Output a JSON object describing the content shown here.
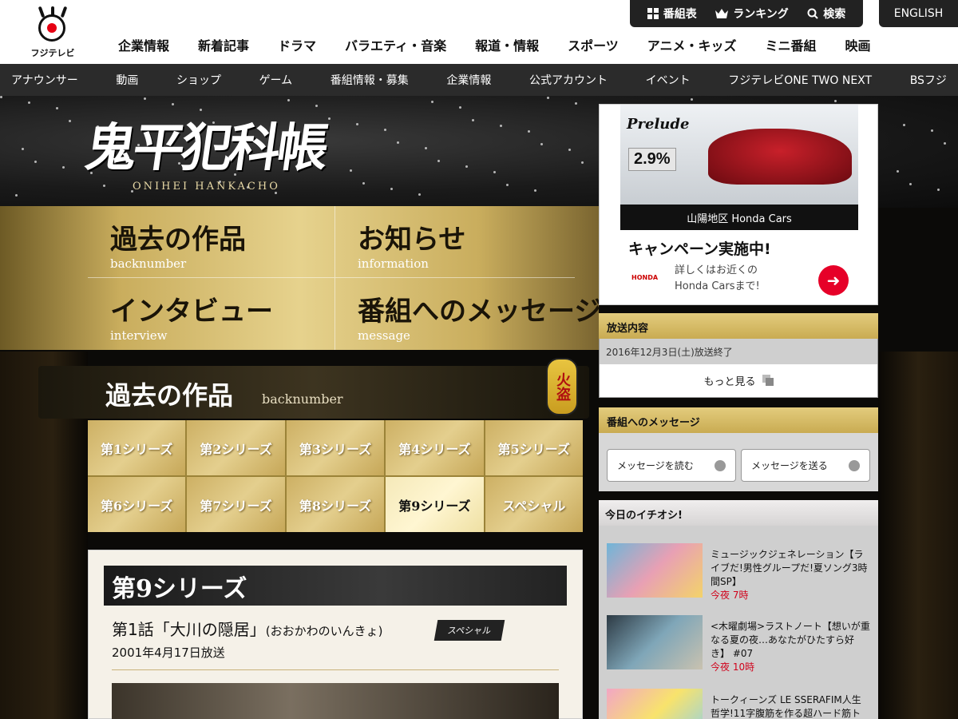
{
  "header": {
    "logo_text": "フジテレビ",
    "util": [
      {
        "icon": "grid-icon",
        "label": "番組表"
      },
      {
        "icon": "crown-icon",
        "label": "ランキング"
      },
      {
        "icon": "search-icon",
        "label": "検索"
      }
    ],
    "english": "ENGLISH",
    "main_nav": [
      "企業情報",
      "新着記事",
      "ドラマ",
      "バラエティ・音楽",
      "報道・情報",
      "スポーツ",
      "アニメ・キッズ",
      "ミニ番組",
      "映画"
    ],
    "sub_nav": [
      "アナウンサー",
      "動画",
      "ショップ",
      "ゲーム",
      "番組情報・募集",
      "企業情報",
      "公式アカウント",
      "イベント",
      "フジテレビONE TWO NEXT",
      "BSフジ"
    ]
  },
  "hero": {
    "title": "鬼平犯科帳",
    "subtitle": "ONIHEI HANKACHO",
    "menu": [
      {
        "jp": "過去の作品",
        "en": "backnumber"
      },
      {
        "jp": "お知らせ",
        "en": "information"
      },
      {
        "jp": "インタビュー",
        "en": "interview"
      },
      {
        "jp": "番組へのメッセージ",
        "en": "message"
      }
    ]
  },
  "backnumber": {
    "heading_jp": "過去の作品",
    "heading_en": "backnumber",
    "lantern": "火盗",
    "series": [
      "第1シリーズ",
      "第2シリーズ",
      "第3シリーズ",
      "第4シリーズ",
      "第5シリーズ",
      "第6シリーズ",
      "第7シリーズ",
      "第8シリーズ",
      "第9シリーズ",
      "スペシャル"
    ],
    "selected_index": 8
  },
  "episode": {
    "series_title": "第9シリーズ",
    "title": "第1話「大川の隠居」",
    "yomi": "(おおかわのいんきょ)",
    "badge": "スペシャル",
    "date": "2001年4月17日放送"
  },
  "ad": {
    "brand": "Prelude",
    "rate": "2.9%",
    "rate_note": "キャンペーン実施中",
    "dealer": "山陽地区 Honda Cars",
    "heading": "キャンペーン実施中!",
    "body": "詳しくはお近くのHonda Carsまで!",
    "honda": "HONDA"
  },
  "broadcast": {
    "heading": "放送内容",
    "date": "2016年12月3日(土)放送終了",
    "more": "もっと見る"
  },
  "message": {
    "heading": "番組へのメッセージ",
    "read": "メッセージを読む",
    "send": "メッセージを送る"
  },
  "pickup": {
    "heading": "今日のイチオシ!",
    "items": [
      {
        "title": "ミュージックジェネレーション【ライブだ!男性グループだ!夏ソング3時間SP】",
        "time": "今夜 7時"
      },
      {
        "title": "<木曜劇場>ラストノート【想いが重なる夏の夜…あなたがひたすら好き】 #07",
        "time": "今夜 10時"
      },
      {
        "title": "トークィーンズ LE SSERAFIM人生哲学!11字腹筋を作る超ハード筋ト",
        "time": ""
      }
    ]
  },
  "colors": {
    "gold": "#d4bb6c",
    "red": "#e60012",
    "dark": "#222222"
  }
}
